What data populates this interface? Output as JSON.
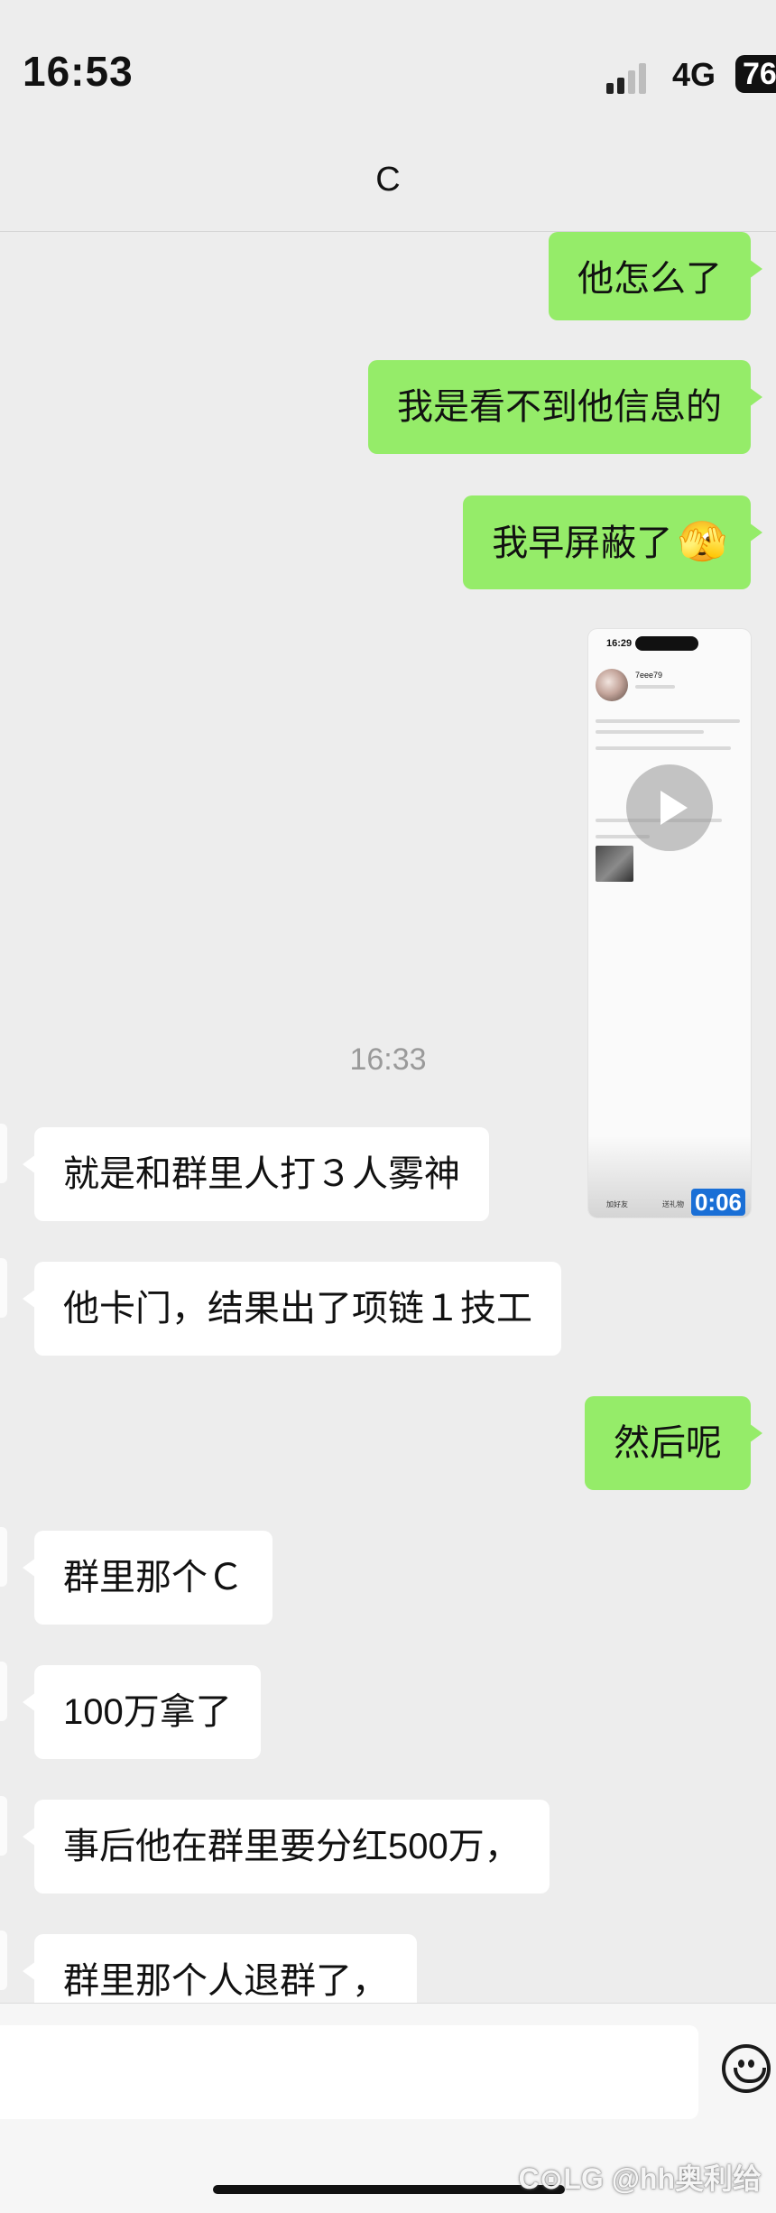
{
  "status_bar": {
    "time": "16:53",
    "network": "4G",
    "battery": "76"
  },
  "header": {
    "title": "C"
  },
  "messages": [
    {
      "side": "right",
      "text": "他怎么了"
    },
    {
      "side": "right",
      "text": "我是看不到他信息的"
    },
    {
      "side": "right",
      "text": "我早屏蔽了",
      "emoji": "🫣"
    },
    {
      "side": "right",
      "type": "video",
      "duration": "0:06",
      "preview": {
        "time": "16:29",
        "name": "7eee79",
        "left_button": "加好友",
        "right_button": "送礼物"
      }
    },
    {
      "type": "timestamp",
      "text": "16:33"
    },
    {
      "side": "left",
      "text": "就是和群里人打３人雾神"
    },
    {
      "side": "left",
      "text": "他卡门，结果出了项链１技工"
    },
    {
      "side": "right",
      "text": "然后呢"
    },
    {
      "side": "left",
      "text": "群里那个Ｃ"
    },
    {
      "side": "left",
      "text": "100万拿了"
    },
    {
      "side": "left",
      "text": "事后他在群里要分红500万，"
    },
    {
      "side": "left",
      "text": "群里那个人退群了，"
    }
  ],
  "input_bar": {
    "emoji_icon": "smiley-face-icon"
  },
  "watermark": "C⊙LG @hh奥利给",
  "colors": {
    "sent_bubble": "#95ec69",
    "received_bubble": "#ffffff",
    "background": "#ededed"
  }
}
